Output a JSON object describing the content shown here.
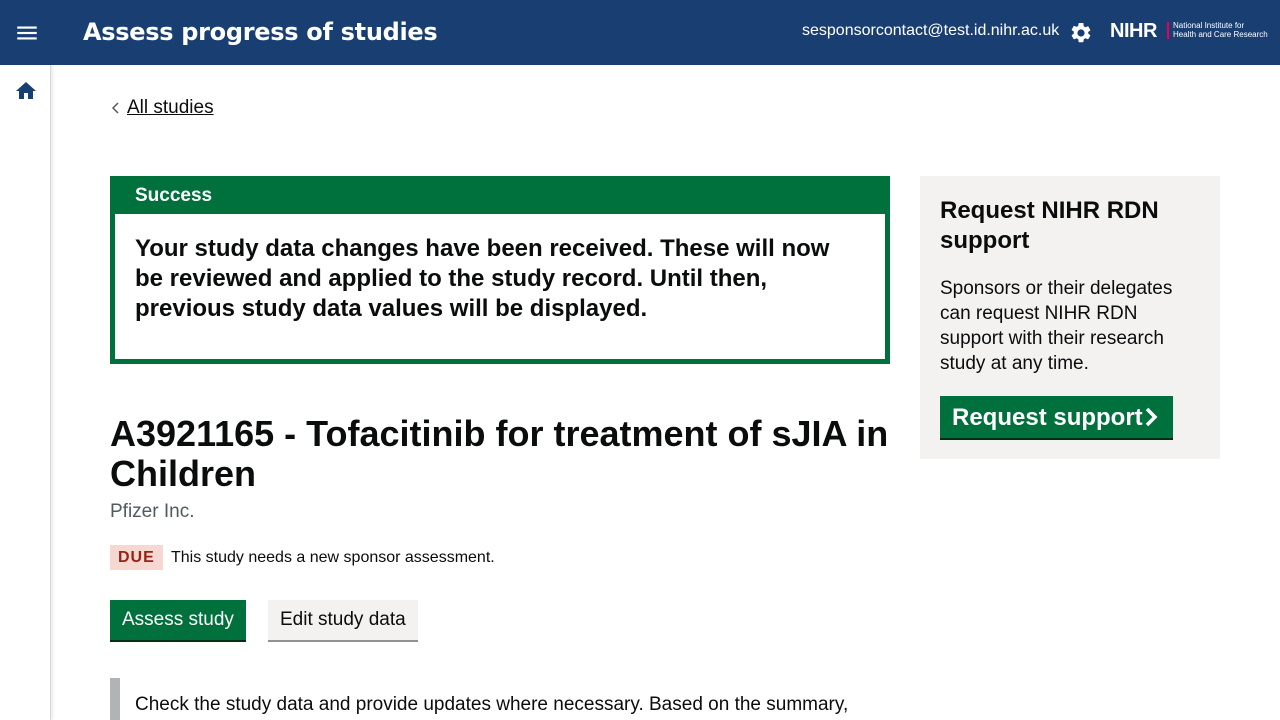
{
  "header": {
    "app_title": "Assess progress of studies",
    "user_email": "sesponsorcontact@test.id.nihr.ac.uk",
    "logo": {
      "name": "NIHR",
      "subtitle_line1": "National Institute for",
      "subtitle_line2": "Health and Care Research"
    },
    "icons": {
      "menu": "menu-icon",
      "settings": "gear-icon"
    }
  },
  "sidenav": {
    "icons": {
      "home": "home-icon"
    }
  },
  "back_link": {
    "label": "All studies"
  },
  "success_banner": {
    "title": "Success",
    "message": "Your study data changes have been received. These will now be reviewed and applied to the study record. Until then, previous study data values will be displayed."
  },
  "study": {
    "title": "A3921165 - Tofacitinib for treatment of sJIA in Children",
    "sponsor": "Pfizer Inc.",
    "status_tag": "DUE",
    "status_text": "This study needs a new sponsor assessment."
  },
  "actions": {
    "assess_label": "Assess study",
    "edit_label": "Edit study data"
  },
  "inset": {
    "text": "Check the study data and provide updates where necessary. Based on the summary,"
  },
  "aside": {
    "heading": "Request NIHR RDN support",
    "body": "Sponsors or their delegates can request NIHR RDN support with their research study at any time.",
    "cta_label": "Request support"
  },
  "colors": {
    "header_bg": "#193e72",
    "primary_green": "#00703c",
    "due_tag_bg": "#f6d7d2",
    "due_tag_text": "#942514",
    "aside_bg": "#f3f2f1"
  }
}
